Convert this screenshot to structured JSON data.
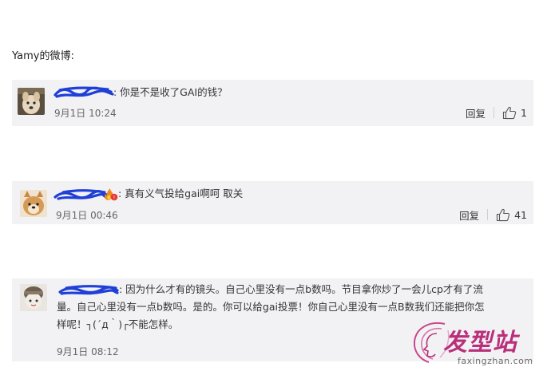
{
  "heading": "Yamy的微博:",
  "comments": [
    {
      "text": ": 你是不是收了GAI的钱？",
      "time": "9月1日 10:24",
      "reply_label": "回复",
      "likes": "1"
    },
    {
      "text": ": 真有义气投给gai啊呵 取关",
      "time": "9月1日 00:46",
      "reply_label": "回复",
      "likes": "41"
    },
    {
      "text_lines": [
        ": 因为什么才有的镜头。自己心里没有一点b数吗。节目拿你炒了一会儿cp才有了流",
        "量。自己心里没有一点b数吗。是的。你可以给gai投票！你自己心里没有一点B数我们还能把你怎",
        "样呢！┐(´д｀)┌不能怎样。"
      ],
      "time": "9月1日 08:12"
    }
  ],
  "watermark": {
    "brand": "发型站",
    "url": "faxingzhan.com"
  },
  "colors": {
    "card_bg": "#f2f2f5",
    "scribble": "#1f3fd6",
    "watermark": "#b9307a"
  }
}
